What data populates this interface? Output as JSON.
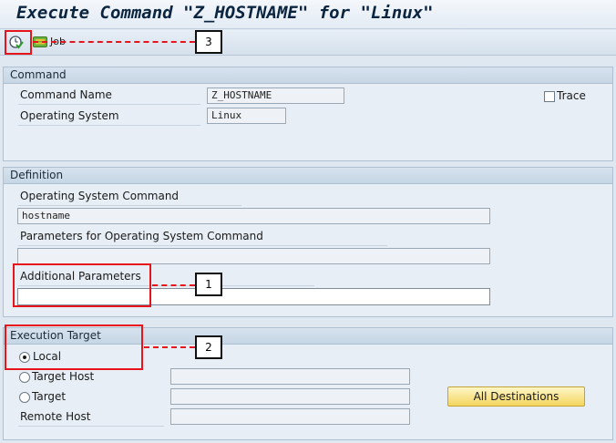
{
  "window": {
    "title": "Execute Command \"Z_HOSTNAME\" for \"Linux\""
  },
  "toolbar": {
    "execute_icon": "execute-clock-check-icon",
    "job_icon": "background-job-icon",
    "job_label": "Job"
  },
  "command": {
    "header": "Command",
    "name_label": "Command Name",
    "name_value": "Z_HOSTNAME",
    "os_label": "Operating System",
    "os_value": "Linux",
    "trace_label": "Trace",
    "trace_checked": false
  },
  "definition": {
    "header": "Definition",
    "os_command_label": "Operating System Command",
    "os_command_value": "hostname",
    "params_label": "Parameters for Operating System Command",
    "params_value": "",
    "additional_label": "Additional Parameters",
    "additional_value": ""
  },
  "execution": {
    "header": "Execution Target",
    "local_label": "Local",
    "target_host_label": "Target Host",
    "target_label": "Target",
    "remote_host_label": "Remote Host",
    "selected": "Local",
    "all_destinations_label": "All Destinations"
  },
  "annotations": {
    "callout_1": "1",
    "callout_2": "2",
    "callout_3": "3"
  },
  "colors": {
    "highlight": "#e8141c",
    "button_accent": "#f3d55d",
    "background": "#dfe8f1"
  }
}
